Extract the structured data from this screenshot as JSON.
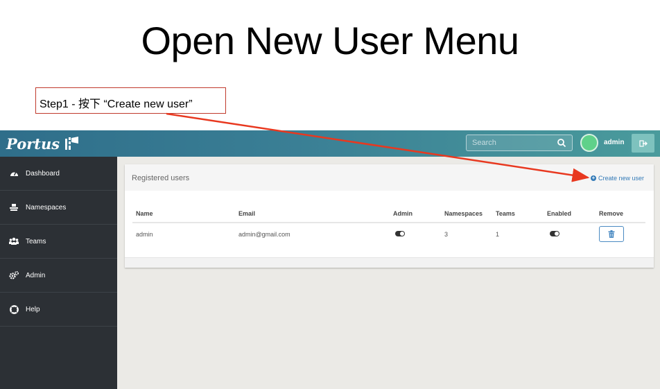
{
  "slide": {
    "title": "Open New User Menu",
    "callout": "Step1 - 按下 “Create new user”"
  },
  "app": {
    "logo_text": "Portus",
    "search": {
      "placeholder": "Search"
    },
    "user": {
      "name": "admin"
    },
    "sidebar": {
      "items": [
        {
          "label": "Dashboard",
          "icon": "dashboard-icon"
        },
        {
          "label": "Namespaces",
          "icon": "namespaces-icon"
        },
        {
          "label": "Teams",
          "icon": "teams-icon"
        },
        {
          "label": "Admin",
          "icon": "admin-gears-icon"
        },
        {
          "label": "Help",
          "icon": "help-lifebuoy-icon"
        }
      ]
    },
    "panel": {
      "title": "Registered users",
      "create_label": "Create new user",
      "columns": [
        "Name",
        "Email",
        "Admin",
        "Namespaces",
        "Teams",
        "Enabled",
        "Remove"
      ],
      "rows": [
        {
          "name": "admin",
          "email": "admin@gmail.com",
          "admin": true,
          "namespaces": "3",
          "teams": "1",
          "enabled": true
        }
      ]
    },
    "colors": {
      "topbar_start": "#2f6e8a",
      "topbar_end": "#4a9b9c",
      "sidebar": "#2c3035",
      "link": "#337ab7",
      "annotation": "#e8381f"
    }
  }
}
